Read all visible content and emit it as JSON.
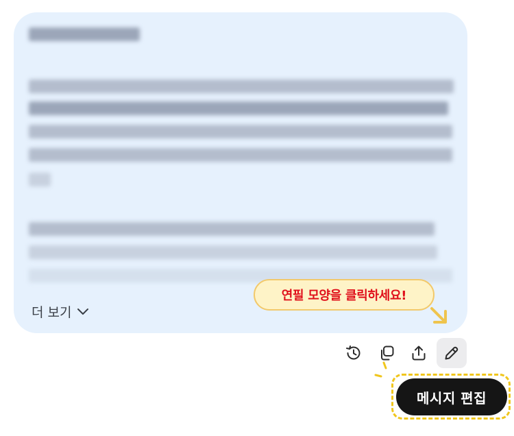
{
  "message": {
    "more_label": "더 보기",
    "more_icon": "chevron-down-icon",
    "background": "#e6f1fd"
  },
  "tooltip": {
    "text": "연필 모양을 클릭하세요!",
    "text_color": "#e0101b",
    "background": "#fef3c7"
  },
  "actions": [
    {
      "icon": "history-icon"
    },
    {
      "icon": "copy-icon"
    },
    {
      "icon": "share-icon"
    },
    {
      "icon": "pencil-icon",
      "active": true
    }
  ],
  "callout": {
    "label": "메시지 편집",
    "highlight_color": "#f0c61d"
  }
}
